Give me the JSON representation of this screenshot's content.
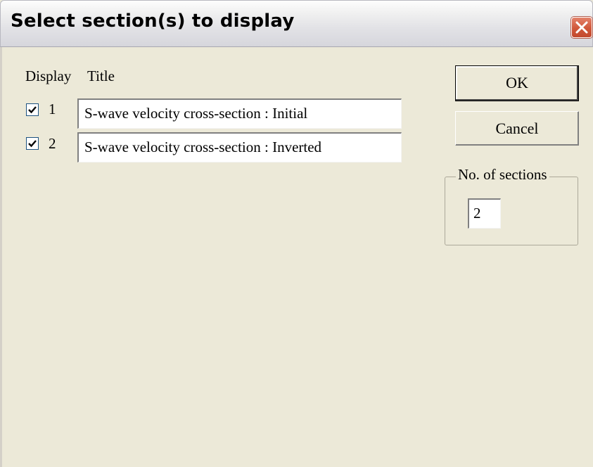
{
  "window": {
    "title": "Select section(s) to display"
  },
  "header": {
    "display_label": "Display",
    "title_label": "Title"
  },
  "sections": [
    {
      "number": "1",
      "checked": true,
      "title": "S-wave velocity cross-section : Initial"
    },
    {
      "number": "2",
      "checked": true,
      "title": "S-wave velocity cross-section : Inverted"
    }
  ],
  "buttons": {
    "ok_label": "OK",
    "cancel_label": "Cancel"
  },
  "sections_count": {
    "label": "No. of sections",
    "value": "2"
  },
  "colors": {
    "dialog_background": "#ece9d8",
    "close_button": "#d0573a",
    "check_border": "#1c5180"
  }
}
